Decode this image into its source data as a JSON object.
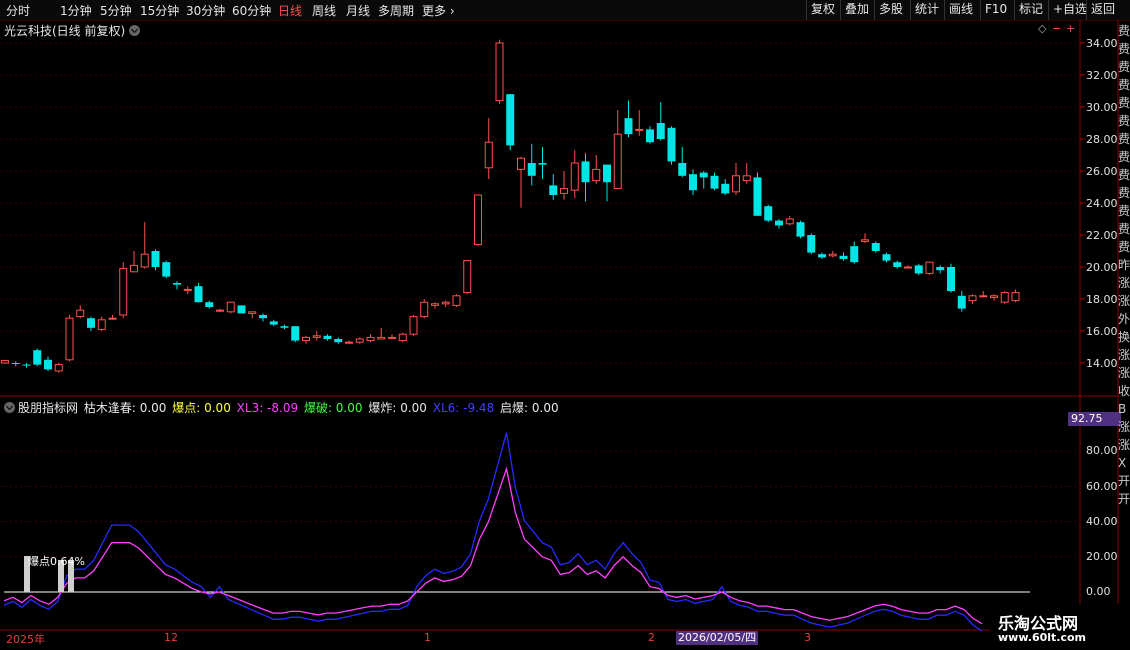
{
  "toolbar": {
    "timeframes": [
      "分时",
      "1分钟",
      "5分钟",
      "15分钟",
      "30分钟",
      "60分钟",
      "日线",
      "周线",
      "月线",
      "多周期",
      "更多"
    ],
    "buttons": [
      "复权",
      "叠加",
      "多股",
      "统计",
      "画线",
      "F10",
      "标记",
      "+自选",
      "返回"
    ]
  },
  "stock": {
    "title": "光云科技(日线 前复权)"
  },
  "indicator": {
    "name": "股朋指标网",
    "items": [
      {
        "text": "枯木逢春: 0.00",
        "color": "#e8e8e8"
      },
      {
        "text": "爆点: 0.00",
        "color": "#ffff40"
      },
      {
        "text": "XL3: -8.09",
        "color": "#ff40ff"
      },
      {
        "text": "爆破: 0.00",
        "color": "#40ff40"
      },
      {
        "text": "爆炸: 0.00",
        "color": "#e8e8e8"
      },
      {
        "text": "XL6: -9.48",
        "color": "#4040ff"
      },
      {
        "text": "启爆: 0.00",
        "color": "#e8e8e8"
      }
    ],
    "current_value": "92.75",
    "marker_label": "爆点0.64%"
  },
  "price_axis": [
    "34.00",
    "32.00",
    "30.00",
    "28.00",
    "26.00",
    "24.00",
    "22.00",
    "20.00",
    "18.00",
    "16.00",
    "14.00"
  ],
  "ind_axis": [
    "80.00",
    "60.00",
    "40.00",
    "20.00",
    "0.00"
  ],
  "x_labels": [
    "2025年",
    "12",
    "1",
    "2",
    "3"
  ],
  "crosshair_date": "2026/02/05/四",
  "right_panel": [
    "费",
    "费",
    "费",
    "费",
    "费",
    "费",
    "费",
    "费",
    "费",
    "费",
    "费",
    "费",
    "费",
    "昨",
    "涨",
    "涨",
    "外",
    "换",
    "涨",
    "涨",
    "收",
    "",
    "",
    "",
    "",
    "",
    "",
    "B",
    "涨",
    "涨",
    "X",
    "开",
    "开"
  ],
  "watermark": {
    "line1": "乐淘公式网",
    "line2": "www.60lt.com"
  },
  "colors": {
    "up": "#ff5050",
    "down": "#00e5e5",
    "grid": "#400000",
    "xl3": "#ff40ff",
    "xl6": "#2828ff"
  },
  "candles": [
    [
      14.0,
      14.15,
      13.95,
      14.2
    ],
    [
      14.0,
      13.95,
      13.8,
      14.1
    ],
    [
      13.9,
      13.85,
      13.7,
      14.0
    ],
    [
      14.8,
      13.9,
      13.8,
      14.9
    ],
    [
      14.2,
      13.6,
      13.5,
      14.4
    ],
    [
      13.5,
      13.9,
      13.4,
      14.0
    ],
    [
      14.2,
      16.8,
      14.1,
      17.0
    ],
    [
      16.9,
      17.3,
      16.8,
      17.6
    ],
    [
      16.8,
      16.2,
      16.0,
      16.9
    ],
    [
      16.1,
      16.7,
      16.0,
      16.9
    ],
    [
      16.8,
      16.8,
      16.7,
      17.0
    ],
    [
      17.0,
      19.9,
      16.8,
      20.3
    ],
    [
      19.7,
      20.1,
      19.7,
      21.0
    ],
    [
      20.0,
      20.8,
      19.9,
      22.8
    ],
    [
      21.0,
      20.0,
      19.8,
      21.1
    ],
    [
      20.3,
      19.4,
      19.3,
      20.4
    ],
    [
      19.0,
      18.9,
      18.6,
      19.1
    ],
    [
      18.6,
      18.6,
      18.3,
      18.8
    ],
    [
      18.8,
      17.8,
      17.8,
      19.0
    ],
    [
      17.8,
      17.5,
      17.4,
      17.9
    ],
    [
      17.3,
      17.3,
      17.2,
      17.4
    ],
    [
      17.2,
      17.8,
      17.1,
      17.8
    ],
    [
      17.6,
      17.1,
      17.1,
      17.6
    ],
    [
      17.1,
      17.2,
      16.8,
      17.2
    ],
    [
      17.0,
      16.8,
      16.6,
      17.1
    ],
    [
      16.6,
      16.4,
      16.3,
      16.7
    ],
    [
      16.3,
      16.2,
      16.1,
      16.4
    ],
    [
      16.3,
      15.4,
      15.3,
      16.3
    ],
    [
      15.4,
      15.6,
      15.2,
      15.7
    ],
    [
      15.6,
      15.7,
      15.4,
      16.0
    ],
    [
      15.7,
      15.5,
      15.4,
      15.8
    ],
    [
      15.5,
      15.3,
      15.2,
      15.6
    ],
    [
      15.3,
      15.3,
      15.2,
      15.4
    ],
    [
      15.3,
      15.5,
      15.2,
      15.6
    ],
    [
      15.4,
      15.6,
      15.3,
      15.8
    ],
    [
      15.5,
      15.6,
      15.5,
      16.2
    ],
    [
      15.6,
      15.6,
      15.5,
      15.8
    ],
    [
      15.4,
      15.8,
      15.3,
      15.9
    ],
    [
      15.8,
      16.9,
      15.7,
      17.0
    ],
    [
      16.9,
      17.8,
      16.8,
      18.0
    ],
    [
      17.6,
      17.7,
      17.4,
      17.8
    ],
    [
      17.7,
      17.8,
      17.5,
      17.9
    ],
    [
      17.6,
      18.2,
      17.5,
      18.3
    ],
    [
      18.4,
      20.4,
      18.3,
      20.4
    ],
    [
      21.4,
      24.5,
      21.3,
      24.5
    ],
    [
      26.2,
      27.8,
      25.5,
      29.3
    ],
    [
      30.4,
      34.0,
      30.2,
      34.2
    ],
    [
      30.8,
      27.6,
      27.3,
      30.8
    ],
    [
      26.1,
      26.8,
      23.7,
      26.9
    ],
    [
      26.5,
      25.7,
      25.1,
      27.7
    ],
    [
      26.5,
      26.4,
      25.5,
      27.5
    ],
    [
      25.1,
      24.5,
      24.2,
      25.8
    ],
    [
      24.6,
      24.9,
      24.2,
      26.0
    ],
    [
      24.8,
      26.5,
      24.3,
      27.3
    ],
    [
      26.6,
      25.3,
      24.1,
      27.1
    ],
    [
      25.4,
      26.1,
      25.2,
      27.0
    ],
    [
      26.4,
      25.3,
      24.1,
      26.4
    ],
    [
      24.9,
      28.3,
      24.9,
      29.8
    ],
    [
      29.3,
      28.3,
      28.1,
      30.4
    ],
    [
      28.6,
      28.6,
      28.2,
      29.8
    ],
    [
      28.6,
      27.8,
      27.7,
      28.8
    ],
    [
      29.0,
      28.0,
      27.9,
      30.3
    ],
    [
      28.7,
      26.6,
      26.4,
      28.8
    ],
    [
      26.5,
      25.7,
      25.6,
      27.5
    ],
    [
      25.8,
      24.8,
      24.5,
      26.1
    ],
    [
      25.9,
      25.6,
      24.9,
      26.0
    ],
    [
      25.7,
      24.9,
      24.8,
      25.9
    ],
    [
      25.2,
      24.6,
      24.5,
      25.5
    ],
    [
      24.7,
      25.7,
      24.5,
      26.5
    ],
    [
      25.4,
      25.7,
      25.2,
      26.5
    ],
    [
      25.6,
      23.2,
      23.2,
      25.9
    ],
    [
      23.8,
      22.9,
      22.8,
      23.9
    ],
    [
      22.9,
      22.6,
      22.4,
      23.0
    ],
    [
      22.7,
      23.0,
      22.6,
      23.2
    ],
    [
      22.8,
      21.9,
      21.8,
      22.9
    ],
    [
      22.0,
      20.9,
      20.8,
      22.1
    ],
    [
      20.8,
      20.6,
      20.5,
      20.9
    ],
    [
      20.7,
      20.8,
      20.6,
      21.0
    ],
    [
      20.7,
      20.5,
      20.4,
      20.9
    ],
    [
      21.3,
      20.3,
      20.2,
      21.6
    ],
    [
      21.6,
      21.7,
      21.5,
      22.1
    ],
    [
      21.5,
      21.0,
      20.9,
      21.6
    ],
    [
      20.8,
      20.4,
      20.3,
      20.9
    ],
    [
      20.3,
      20.0,
      19.9,
      20.4
    ],
    [
      20.0,
      20.0,
      19.9,
      20.1
    ],
    [
      20.1,
      19.6,
      19.5,
      20.2
    ],
    [
      19.6,
      20.3,
      19.5,
      20.3
    ],
    [
      20.0,
      19.8,
      19.6,
      20.1
    ],
    [
      20.0,
      18.5,
      18.4,
      20.2
    ],
    [
      18.2,
      17.4,
      17.2,
      18.5
    ],
    [
      17.9,
      18.2,
      17.7,
      18.3
    ],
    [
      18.2,
      18.2,
      18.1,
      18.5
    ],
    [
      18.1,
      18.2,
      17.9,
      18.3
    ],
    [
      17.8,
      18.4,
      17.7,
      18.5
    ],
    [
      17.9,
      18.4,
      17.8,
      18.6
    ]
  ],
  "xl3": [
    -5,
    -3,
    -6,
    -2,
    -5,
    -7,
    -3,
    5,
    8,
    8,
    12,
    20,
    28,
    28,
    28,
    25,
    20,
    15,
    10,
    8,
    5,
    2,
    0,
    -1,
    0,
    -2,
    -4,
    -6,
    -8,
    -10,
    -12,
    -12,
    -11,
    -11,
    -12,
    -13,
    -12,
    -12,
    -11,
    -10,
    -9,
    -8,
    -8,
    -7,
    -7,
    -5,
    0,
    5,
    8,
    6,
    7,
    9,
    15,
    30,
    40,
    55,
    70,
    45,
    30,
    25,
    20,
    18,
    10,
    11,
    15,
    10,
    12,
    8,
    15,
    20,
    15,
    11,
    3,
    2,
    -2,
    -3,
    -2,
    -4,
    -3,
    -2,
    0,
    -3,
    -5,
    -6,
    -8,
    -8,
    -9,
    -10,
    -10,
    -12,
    -14,
    -15,
    -16,
    -15,
    -14,
    -12,
    -10,
    -8,
    -7,
    -8,
    -10,
    -11,
    -12,
    -12,
    -10,
    -10,
    -8,
    -10,
    -15,
    -18
  ]
}
